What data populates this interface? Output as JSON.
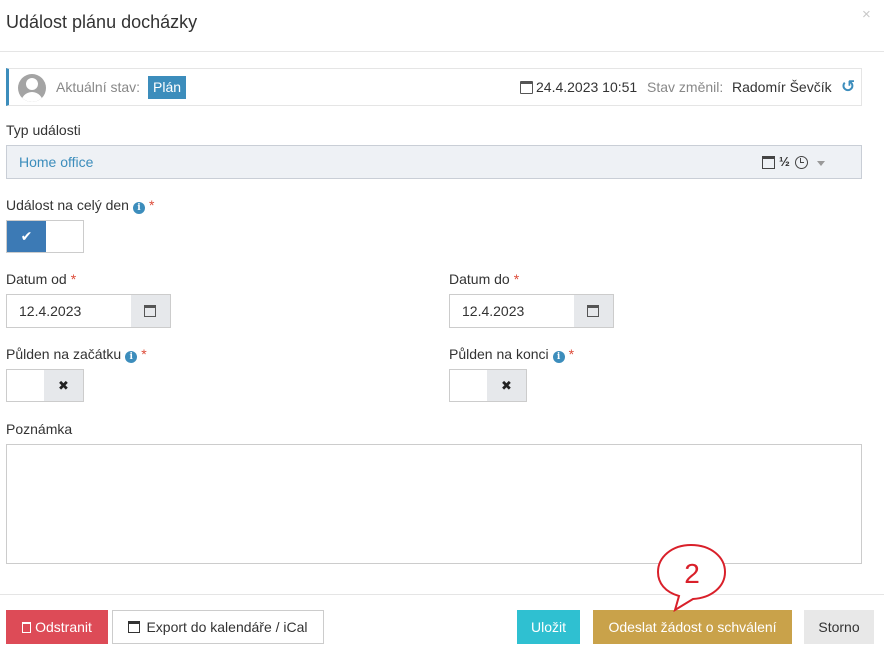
{
  "dialog": {
    "title": "Událost plánu docházky",
    "close_symbol": "×"
  },
  "status": {
    "label": "Aktuální stav:",
    "badge": "Plán",
    "date": "24.4.2023 10:51",
    "changed_label": "Stav změnil:",
    "changed_user": "Radomír Ševčík",
    "history_symbol": "↺"
  },
  "event_type": {
    "label": "Typ události",
    "value": "Home office",
    "half_symbol": "½",
    "icons": [
      "calendar-icon",
      "clock-icon",
      "caret-down-icon"
    ]
  },
  "all_day": {
    "label": "Událost na celý den",
    "required": "*",
    "on_symbol": "✔",
    "checked": true
  },
  "date_from": {
    "label": "Datum od",
    "required": "*",
    "value": "12.4.2023"
  },
  "date_to": {
    "label": "Datum do",
    "required": "*",
    "value": "12.4.2023"
  },
  "half_start": {
    "label": "Půlden na začátku",
    "required": "*",
    "off_symbol": "✖",
    "checked": false
  },
  "half_end": {
    "label": "Půlden na konci",
    "required": "*",
    "off_symbol": "✖",
    "checked": false
  },
  "note": {
    "label": "Poznámka",
    "value": ""
  },
  "buttons": {
    "delete": "Odstranit",
    "export": "Export do kalendáře / iCal",
    "save": "Uložit",
    "submit": "Odeslat žádost o schválení",
    "cancel": "Storno"
  },
  "annotation": {
    "number": "2",
    "color": "#d9202a"
  },
  "colors": {
    "primary": "#3c8dbc",
    "danger": "#dd4b57",
    "info": "#2fc0d1",
    "warning": "#c9a24a"
  }
}
